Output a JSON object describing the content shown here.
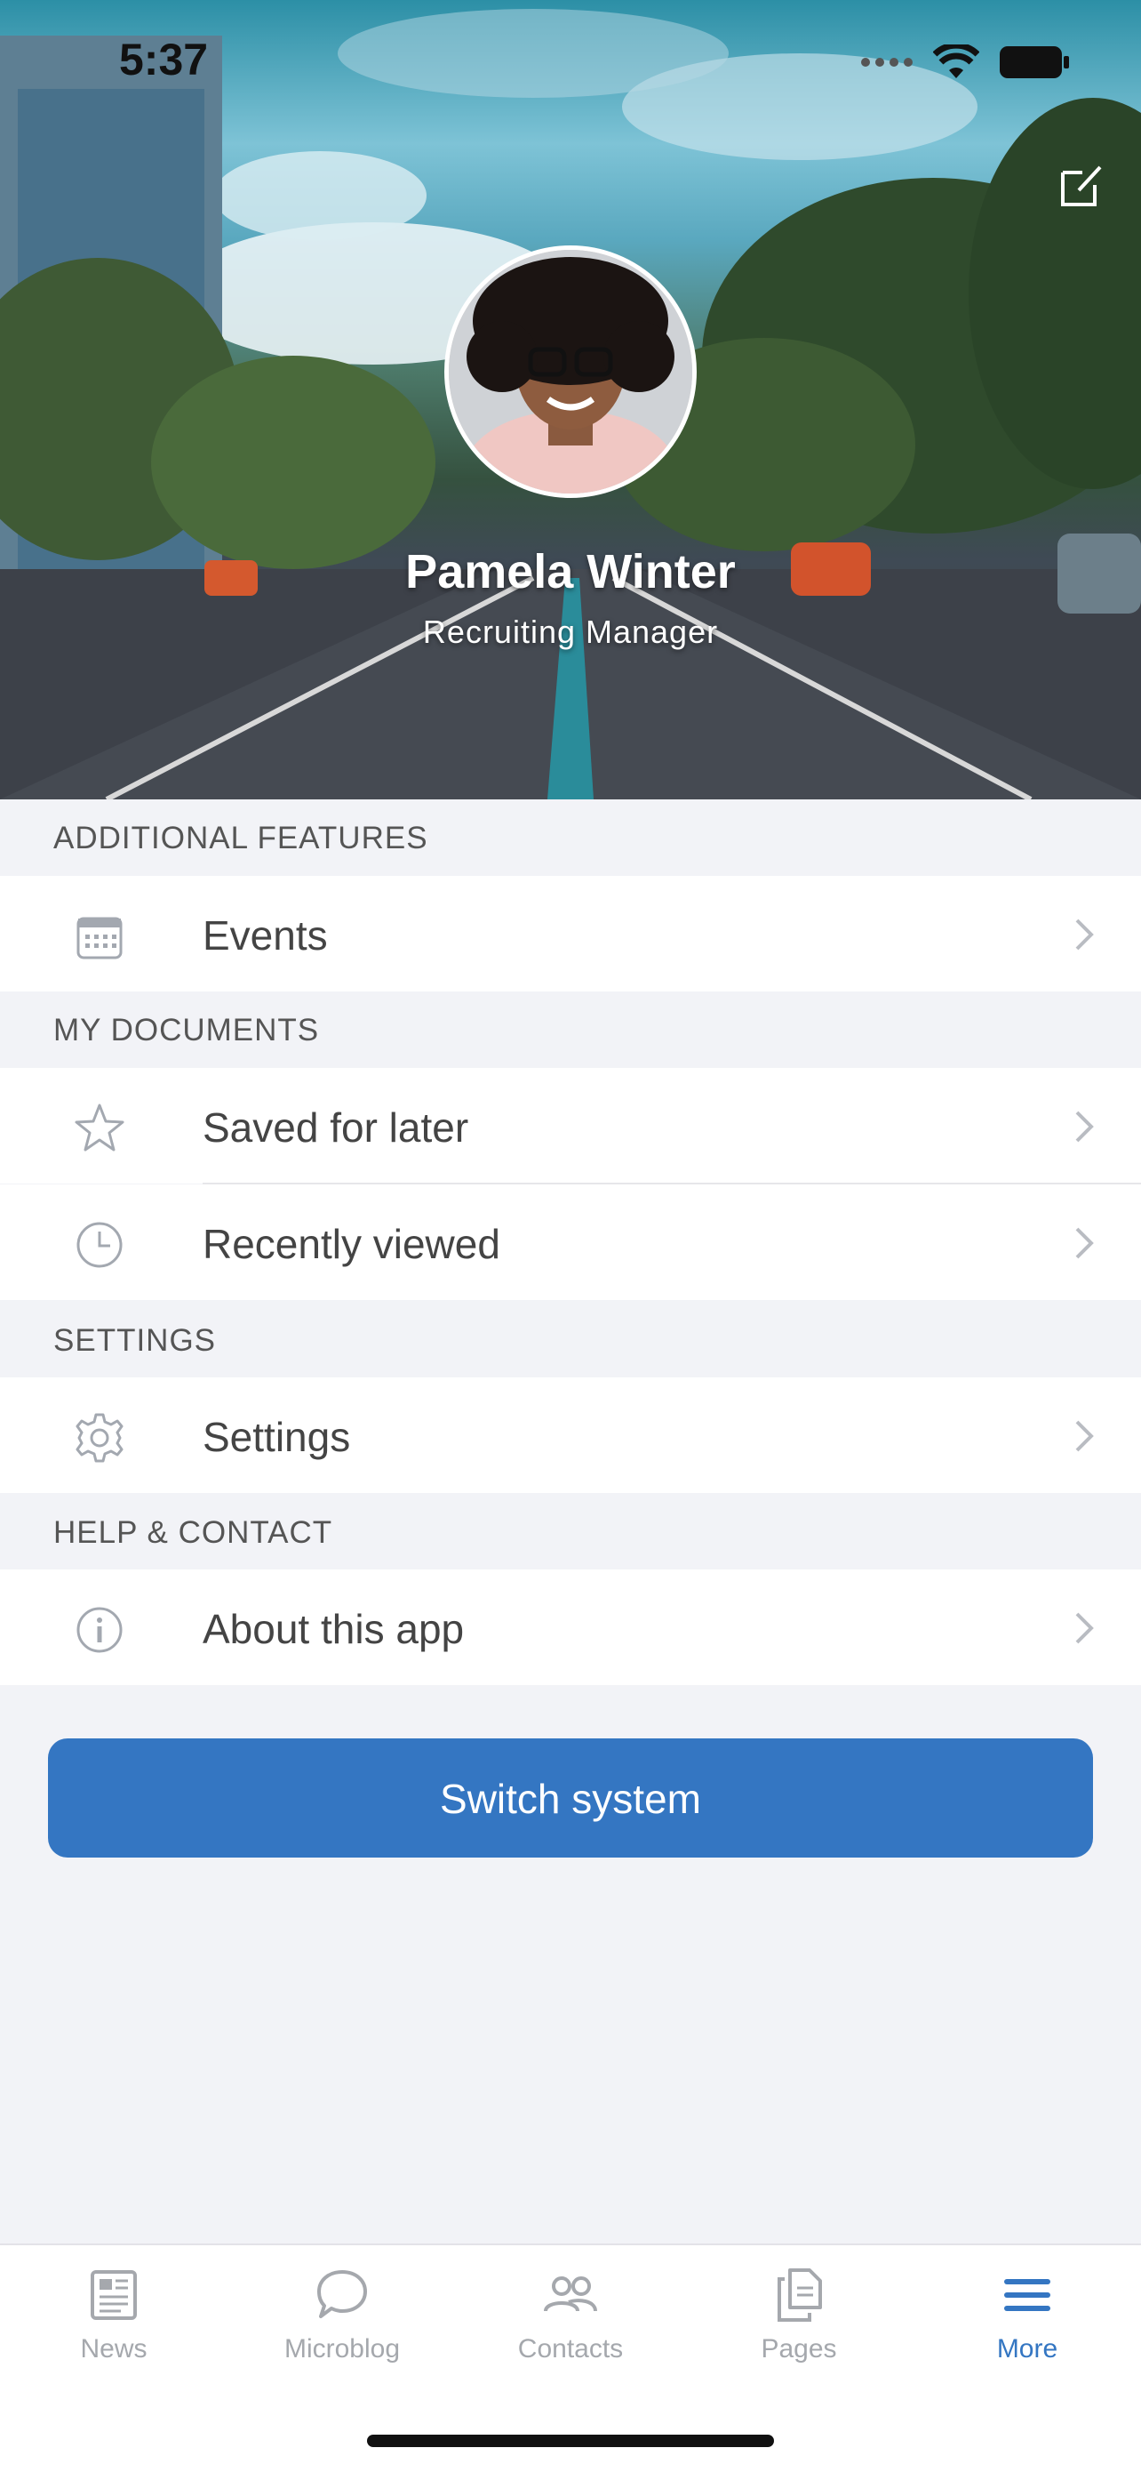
{
  "status_bar": {
    "time": "5:37"
  },
  "profile": {
    "name": "Pamela Winter",
    "role": "Recruiting Manager"
  },
  "sections": [
    {
      "header": "ADDITIONAL FEATURES",
      "items": [
        {
          "label": "Events",
          "icon": "calendar-icon"
        }
      ]
    },
    {
      "header": "MY DOCUMENTS",
      "items": [
        {
          "label": "Saved for later",
          "icon": "star-icon"
        },
        {
          "label": "Recently viewed",
          "icon": "clock-icon"
        }
      ]
    },
    {
      "header": "SETTINGS",
      "items": [
        {
          "label": "Settings",
          "icon": "gear-icon"
        }
      ]
    },
    {
      "header": "HELP & CONTACT",
      "items": [
        {
          "label": "About this app",
          "icon": "info-icon"
        }
      ]
    }
  ],
  "switch_button": {
    "label": "Switch system"
  },
  "tabbar": {
    "tabs": [
      {
        "label": "News",
        "icon": "newspaper-icon",
        "active": false
      },
      {
        "label": "Microblog",
        "icon": "chat-bubble-icon",
        "active": false
      },
      {
        "label": "Contacts",
        "icon": "contacts-icon",
        "active": false
      },
      {
        "label": "Pages",
        "icon": "pages-icon",
        "active": false
      },
      {
        "label": "More",
        "icon": "menu-icon",
        "active": true
      }
    ]
  },
  "colors": {
    "accent": "#3476c2",
    "background": "#f2f3f7",
    "inactive_tab": "#a5a8ad"
  }
}
